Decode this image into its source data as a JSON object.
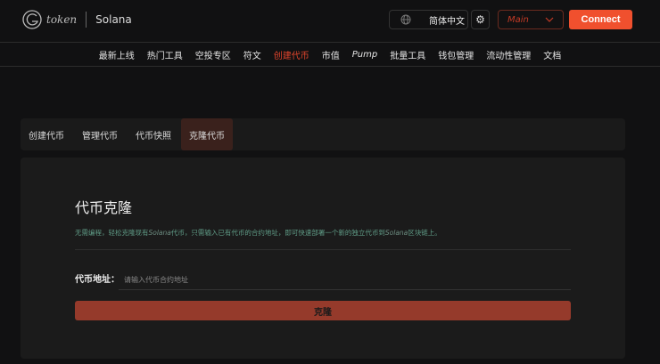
{
  "header": {
    "logo_text": "token",
    "chain": "Solana",
    "language": "简体中文",
    "network": "Main",
    "connect_label": "Connect"
  },
  "nav": [
    {
      "label": "最新上线"
    },
    {
      "label": "热门工具"
    },
    {
      "label": "空投专区"
    },
    {
      "label": "符文"
    },
    {
      "label": "创建代币",
      "active": true
    },
    {
      "label": "市值"
    },
    {
      "label": "Pump"
    },
    {
      "label": "批量工具"
    },
    {
      "label": "钱包管理"
    },
    {
      "label": "流动性管理"
    },
    {
      "label": "文档"
    }
  ],
  "tabs": [
    {
      "label": "创建代币"
    },
    {
      "label": "管理代币"
    },
    {
      "label": "代币快照"
    },
    {
      "label": "克隆代币",
      "active": true
    }
  ],
  "form": {
    "title": "代币克隆",
    "desc_1": "无需编程，轻松克隆现有",
    "desc_solana": "Solana",
    "desc_2": "代币，只需输入已有代币的合约地址，即可快速部署一个新的独立代币到",
    "desc_3": "区块链上。",
    "address_label": "代币地址：",
    "address_placeholder": "请输入代币合约地址",
    "address_value": "",
    "submit_label": "克隆"
  },
  "colors": {
    "accent": "#f0502e",
    "active_nav": "#e5462d",
    "button": "#953a2b"
  }
}
